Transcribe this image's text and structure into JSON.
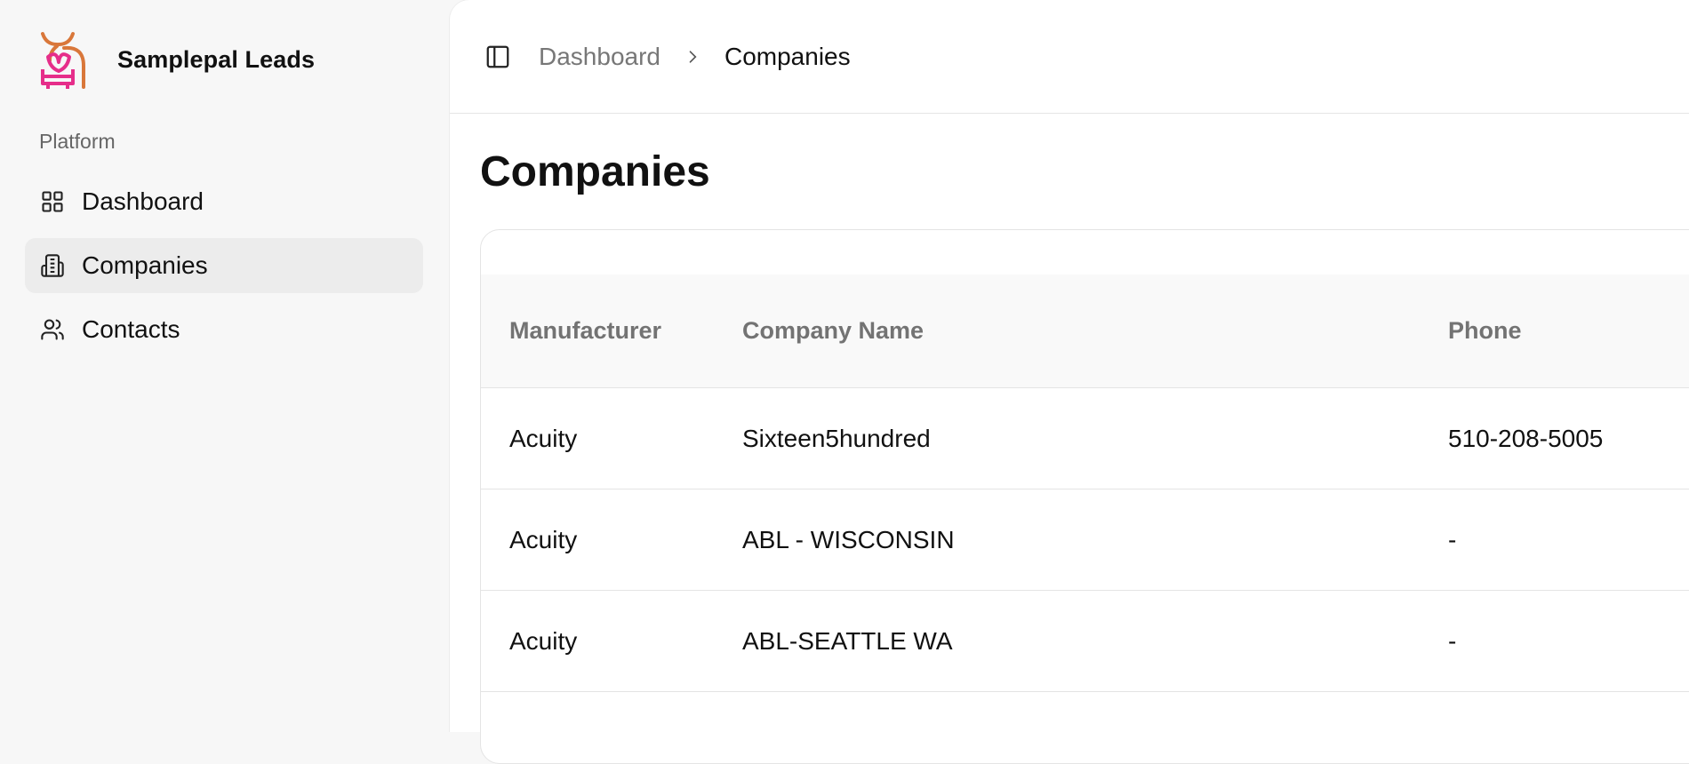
{
  "brand": {
    "name": "Samplepal Leads",
    "logo_icon": "samplepal-logo-icon"
  },
  "sidebar": {
    "section_label": "Platform",
    "items": [
      {
        "label": "Dashboard",
        "icon": "grid-icon",
        "active": false
      },
      {
        "label": "Companies",
        "icon": "building-icon",
        "active": true
      },
      {
        "label": "Contacts",
        "icon": "users-icon",
        "active": false
      }
    ]
  },
  "breadcrumb": {
    "parent": "Dashboard",
    "current": "Companies"
  },
  "page": {
    "title": "Companies"
  },
  "table": {
    "headers": [
      "Manufacturer",
      "Company Name",
      "Phone"
    ],
    "rows": [
      {
        "manufacturer": "Acuity",
        "company": "Sixteen5hundred",
        "phone": "510-208-5005"
      },
      {
        "manufacturer": "Acuity",
        "company": "ABL - WISCONSIN",
        "phone": "-"
      },
      {
        "manufacturer": "Acuity",
        "company": "ABL-SEATTLE WA",
        "phone": "-"
      }
    ]
  },
  "colors": {
    "logo_orange": "#d9773a",
    "logo_pink": "#e62e8a",
    "sidebar_bg": "#f7f7f7",
    "active_bg": "#ececec"
  }
}
